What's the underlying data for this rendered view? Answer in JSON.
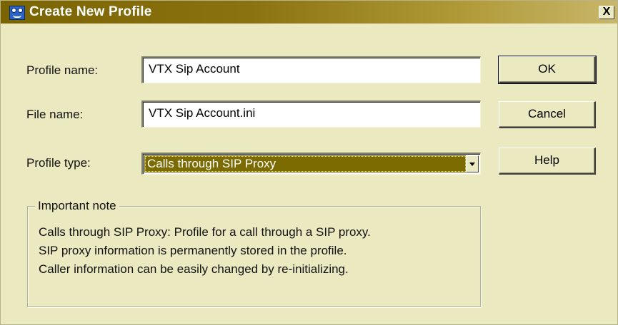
{
  "window": {
    "title": "Create New Profile",
    "close_glyph": "X"
  },
  "form": {
    "profile_name_label": "Profile name:",
    "profile_name_value": "VTX Sip Account",
    "file_name_label": "File name:",
    "file_name_value": "VTX Sip Account.ini",
    "profile_type_label": "Profile type:",
    "profile_type_value": "Calls through SIP Proxy"
  },
  "buttons": {
    "ok": "OK",
    "cancel": "Cancel",
    "help": "Help"
  },
  "note": {
    "title": "Important note",
    "lines": [
      "Calls through SIP Proxy: Profile for a call through a SIP proxy.",
      "SIP proxy information is permanently stored in the profile.",
      "Caller information can be easily changed by re-initializing."
    ]
  },
  "colors": {
    "title_bar": "#7a6400",
    "dialog_bg": "#ebe9c0",
    "selection": "#7b6b00"
  },
  "icons": [
    "app-icon",
    "close-icon",
    "dropdown-arrow-icon"
  ]
}
